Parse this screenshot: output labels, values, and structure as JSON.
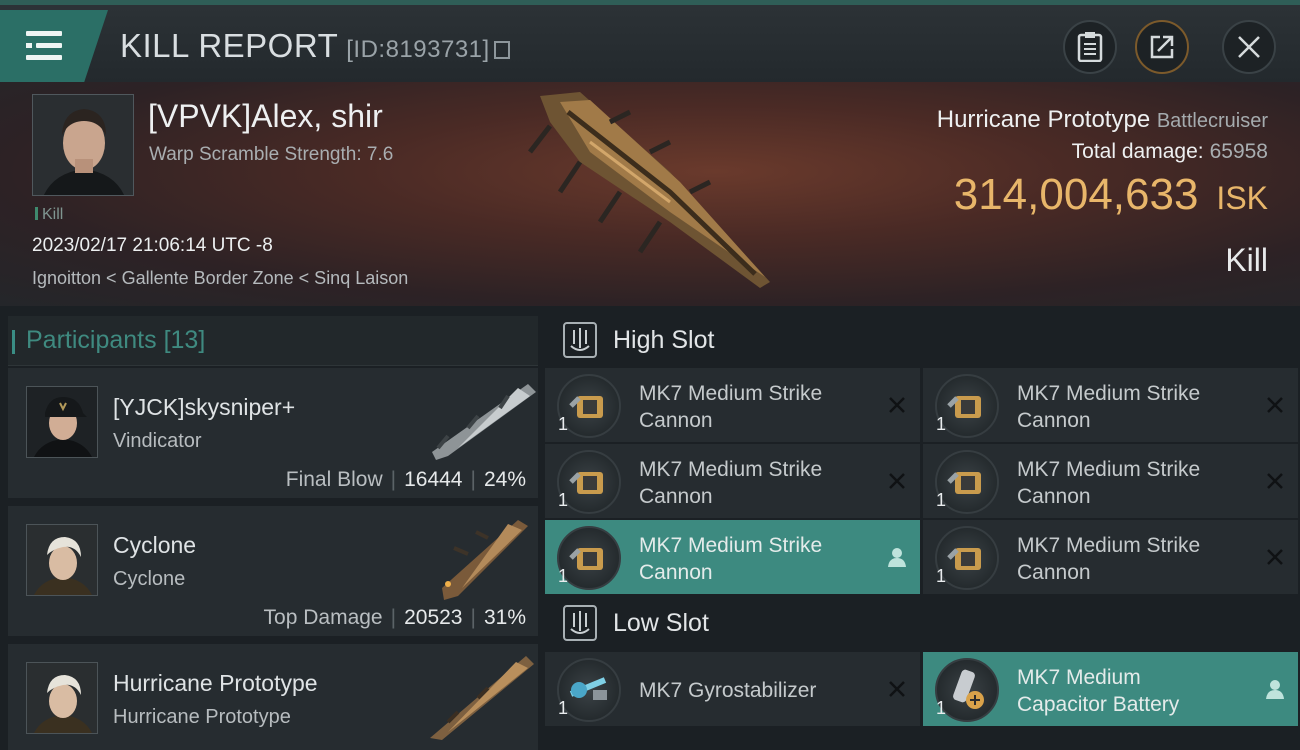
{
  "header": {
    "title": "KILL REPORT",
    "report_id": "[ID:8193731]"
  },
  "victim": {
    "name": "[VPVK]Alex, shir",
    "warp_scramble": "Warp Scramble Strength: 7.6",
    "tag": "Kill",
    "datetime": "2023/02/17 21:06:14 UTC -8",
    "location": "Ignoitton < Gallente Border Zone < Sinq Laison",
    "ship_name": "Hurricane Prototype",
    "ship_class": "Battlecruiser",
    "total_damage_label": "Total damage:",
    "total_damage": "65958",
    "isk_value": "314,004,633",
    "isk_unit": "ISK",
    "result": "Kill"
  },
  "participants": {
    "heading": "Participants",
    "count": "[13]",
    "rows": [
      {
        "name": "[YJCK]skysniper+",
        "ship": "Vindicator",
        "stat_label": "Final Blow",
        "damage": "16444",
        "percent": "24%"
      },
      {
        "name": "Cyclone",
        "ship": "Cyclone",
        "stat_label": "Top Damage",
        "damage": "20523",
        "percent": "31%"
      },
      {
        "name": "Hurricane Prototype",
        "ship": "Hurricane Prototype"
      }
    ]
  },
  "high_slot": {
    "label": "High Slot",
    "modules": [
      {
        "line1": "MK7 Medium Strike",
        "line2": "Cannon",
        "qty": "1"
      },
      {
        "line1": "MK7 Medium Strike",
        "line2": "Cannon",
        "qty": "1"
      },
      {
        "line1": "MK7 Medium Strike",
        "line2": "Cannon",
        "qty": "1"
      },
      {
        "line1": "MK7 Medium Strike",
        "line2": "Cannon",
        "qty": "1"
      },
      {
        "line1": "MK7 Medium Strike",
        "line2": "Cannon",
        "qty": "1"
      },
      {
        "line1": "MK7 Medium Strike",
        "line2": "Cannon",
        "qty": "1"
      }
    ]
  },
  "low_slot": {
    "label": "Low Slot",
    "modules": [
      {
        "line1": "MK7 Gyrostabilizer",
        "qty": "1"
      },
      {
        "line1": "MK7 Medium",
        "line2": "Capacitor Battery",
        "qty": "1"
      }
    ]
  },
  "colors": {
    "accent_teal": "#3d8a80",
    "isk_gold": "#e8b66a"
  },
  "icons": [
    "menu-icon",
    "clipboard-icon",
    "share-icon",
    "close-icon",
    "copy-icon",
    "slot-icon",
    "dropped-x-icon",
    "person-icon"
  ]
}
